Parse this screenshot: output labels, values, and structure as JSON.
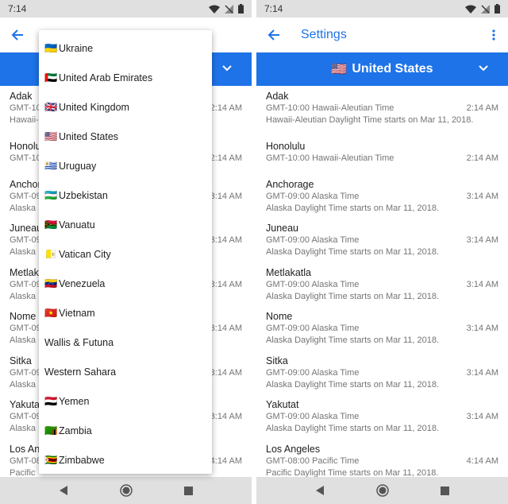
{
  "status": {
    "time": "7:14"
  },
  "appbar": {
    "title": "Settings"
  },
  "selected_country": {
    "flag": "🇺🇸",
    "name": "United States"
  },
  "dropdown": {
    "items": [
      {
        "flag": "🇺🇦",
        "label": "Ukraine"
      },
      {
        "flag": "🇦🇪",
        "label": "United Arab Emirates"
      },
      {
        "flag": "🇬🇧",
        "label": "United Kingdom"
      },
      {
        "flag": "🇺🇸",
        "label": "United States"
      },
      {
        "flag": "🇺🇾",
        "label": "Uruguay"
      },
      {
        "flag": "🇺🇿",
        "label": "Uzbekistan"
      },
      {
        "flag": "🇻🇺",
        "label": "Vanuatu"
      },
      {
        "flag": "🇻🇦",
        "label": "Vatican City"
      },
      {
        "flag": "🇻🇪",
        "label": "Venezuela"
      },
      {
        "flag": "🇻🇳",
        "label": "Vietnam"
      },
      {
        "flag": "",
        "label": "Wallis & Futuna"
      },
      {
        "flag": "",
        "label": "Western Sahara"
      },
      {
        "flag": "🇾🇪",
        "label": "Yemen"
      },
      {
        "flag": "🇿🇲",
        "label": "Zambia"
      },
      {
        "flag": "🇿🇼",
        "label": "Zimbabwe"
      }
    ]
  },
  "left_partial": {
    "cities": [
      "Adak",
      "Honolu",
      "Anchor",
      "Juneau",
      "Metlak",
      "Nome",
      "Sitka",
      "Yakuta",
      "Los An"
    ],
    "offsets": [
      "GMT-10",
      "GMT-10",
      "GMT-09",
      "GMT-09",
      "GMT-09",
      "GMT-09",
      "GMT-09",
      "GMT-09",
      "GMT-08"
    ],
    "dst": [
      "Hawaii-",
      "",
      "Alaska",
      "Alaska",
      "Alaska",
      "Alaska",
      "Alaska",
      "Alaska",
      "Pacific"
    ],
    "times": [
      "2:14 AM",
      "2:14 AM",
      "3:14 AM",
      "3:14 AM",
      "3:14 AM",
      "3:14 AM",
      "3:14 AM",
      "3:14 AM",
      "4:14 AM"
    ]
  },
  "timezones": [
    {
      "city": "Adak",
      "offset": "GMT-10:00 Hawaii-Aleutian Time",
      "time": "2:14 AM",
      "dst": "Hawaii-Aleutian Daylight Time starts on Mar 11, 2018."
    },
    {
      "city": "Honolulu",
      "offset": "GMT-10:00 Hawaii-Aleutian Time",
      "time": "2:14 AM",
      "dst": ""
    },
    {
      "city": "Anchorage",
      "offset": "GMT-09:00 Alaska Time",
      "time": "3:14 AM",
      "dst": "Alaska Daylight Time starts on Mar 11, 2018."
    },
    {
      "city": "Juneau",
      "offset": "GMT-09:00 Alaska Time",
      "time": "3:14 AM",
      "dst": "Alaska Daylight Time starts on Mar 11, 2018."
    },
    {
      "city": "Metlakatla",
      "offset": "GMT-09:00 Alaska Time",
      "time": "3:14 AM",
      "dst": "Alaska Daylight Time starts on Mar 11, 2018."
    },
    {
      "city": "Nome",
      "offset": "GMT-09:00 Alaska Time",
      "time": "3:14 AM",
      "dst": "Alaska Daylight Time starts on Mar 11, 2018."
    },
    {
      "city": "Sitka",
      "offset": "GMT-09:00 Alaska Time",
      "time": "3:14 AM",
      "dst": "Alaska Daylight Time starts on Mar 11, 2018."
    },
    {
      "city": "Yakutat",
      "offset": "GMT-09:00 Alaska Time",
      "time": "3:14 AM",
      "dst": "Alaska Daylight Time starts on Mar 11, 2018."
    },
    {
      "city": "Los Angeles",
      "offset": "GMT-08:00 Pacific Time",
      "time": "4:14 AM",
      "dst": "Pacific Daylight Time starts on Mar 11, 2018."
    }
  ],
  "icons": {
    "back": "arrow-left-icon",
    "overflow": "more-vert-icon",
    "caret": "chevron-down-icon",
    "wifi": "wifi-icon",
    "signal": "signal-off-icon",
    "battery": "battery-icon",
    "nav_back": "nav-back-icon",
    "nav_home": "nav-home-icon",
    "nav_recents": "nav-recents-icon"
  },
  "colors": {
    "accent": "#1e73e8",
    "system_bar": "#e0e0e0",
    "secondary_text": "#757575"
  }
}
